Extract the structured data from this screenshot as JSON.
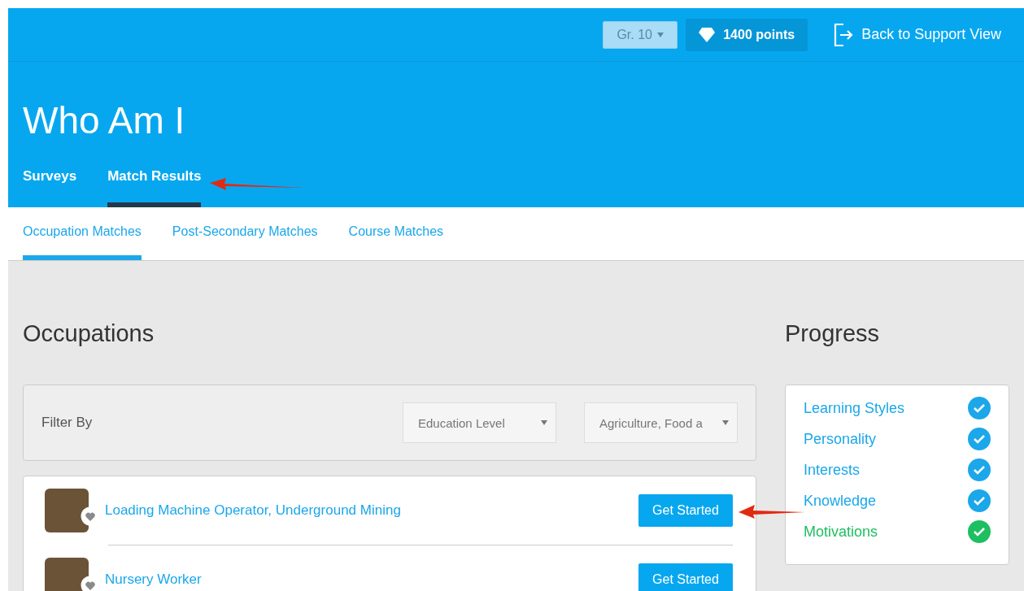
{
  "top_bar": {
    "grade_select": {
      "value": "Gr. 10"
    },
    "points": "1400 points",
    "back_link": "Back to Support View"
  },
  "page_title": "Who Am I",
  "tabs": [
    {
      "label": "Surveys",
      "selected": false
    },
    {
      "label": "Match Results",
      "selected": true
    }
  ],
  "sub_tabs": [
    {
      "label": "Occupation Matches",
      "selected": true
    },
    {
      "label": "Post-Secondary Matches",
      "selected": false
    },
    {
      "label": "Course Matches",
      "selected": false
    }
  ],
  "occupations": {
    "title": "Occupations",
    "filter_label": "Filter By",
    "filters": [
      {
        "value": "Education Level"
      },
      {
        "value": "Agriculture, Food a"
      }
    ],
    "items": [
      {
        "name": "Loading Machine Operator, Underground Mining",
        "button": "Get Started"
      },
      {
        "name": "Nursery Worker",
        "button": "Get Started"
      }
    ]
  },
  "progress": {
    "title": "Progress",
    "items": [
      {
        "label": "Learning Styles",
        "color": "#1ba7ea"
      },
      {
        "label": "Personality",
        "color": "#1ba7ea"
      },
      {
        "label": "Interests",
        "color": "#1ba7ea"
      },
      {
        "label": "Knowledge",
        "color": "#1ba7ea"
      },
      {
        "label": "Motivations",
        "color": "#1dbf60"
      }
    ]
  }
}
